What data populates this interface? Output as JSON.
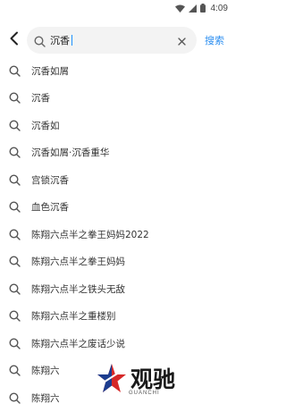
{
  "status_bar": {
    "time": "4:09"
  },
  "search": {
    "query": "沉香",
    "submit_label": "搜索"
  },
  "suggestions": [
    "沉香如屑",
    "沉香",
    "沉香如",
    "沉香如屑·沉香重华",
    "宫锁沉香",
    "血色沉香",
    "陈翔六点半之拳王妈妈2022",
    "陈翔六点半之拳王妈妈",
    "陈翔六点半之铁头无敌",
    "陈翔六点半之重楼别",
    "陈翔六点半之废话少说",
    "陈翔六",
    "陈翔六"
  ],
  "watermark": {
    "title": "观驰",
    "subtitle": "GUANCHI"
  },
  "colors": {
    "accent": "#2b8ef0",
    "text": "#333333",
    "search_bg": "#f3f3f3"
  }
}
